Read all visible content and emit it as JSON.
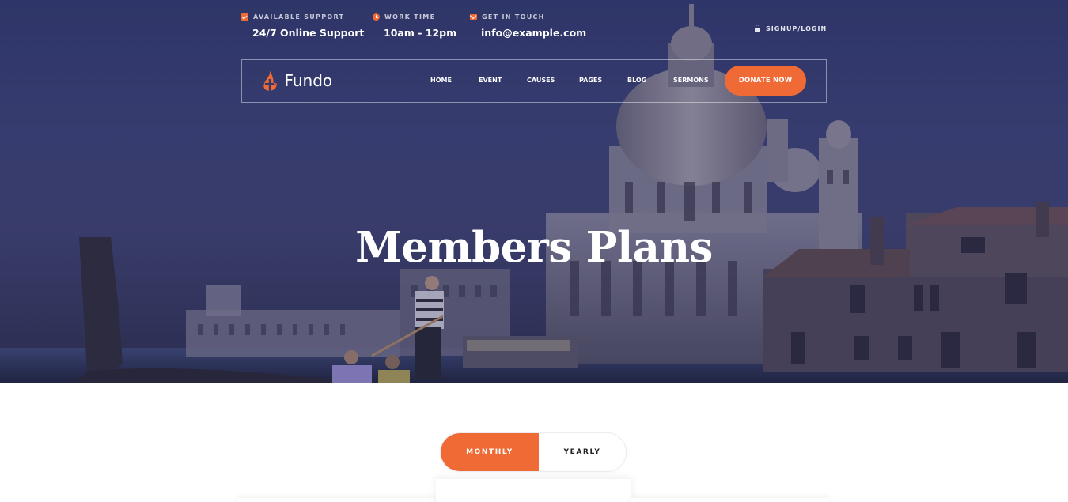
{
  "topbar": {
    "support": {
      "label": "Available Support",
      "value": "24/7 Online Support",
      "icon": "check-square-icon"
    },
    "work_time": {
      "label": "Work Time",
      "value": "10am - 12pm",
      "icon": "clock-icon"
    },
    "contact": {
      "label": "Get In Touch",
      "value": "info@example.com",
      "icon": "envelope-icon"
    },
    "signup": {
      "label": "Signup/Login",
      "icon": "lock-icon"
    }
  },
  "navbar": {
    "logo_text": "Fundo",
    "menu": [
      "Home",
      "Event",
      "Causes",
      "Pages",
      "Blog",
      "Sermons"
    ],
    "donate_label": "Donate Now"
  },
  "hero": {
    "title": "Members Plans"
  },
  "pricing_toggle": {
    "monthly_label": "Monthly",
    "yearly_label": "Yearly",
    "selected": "Monthly"
  },
  "colors": {
    "accent": "#ef6a34",
    "hero_overlay": "#2f3568",
    "text_light": "#ffffff"
  }
}
